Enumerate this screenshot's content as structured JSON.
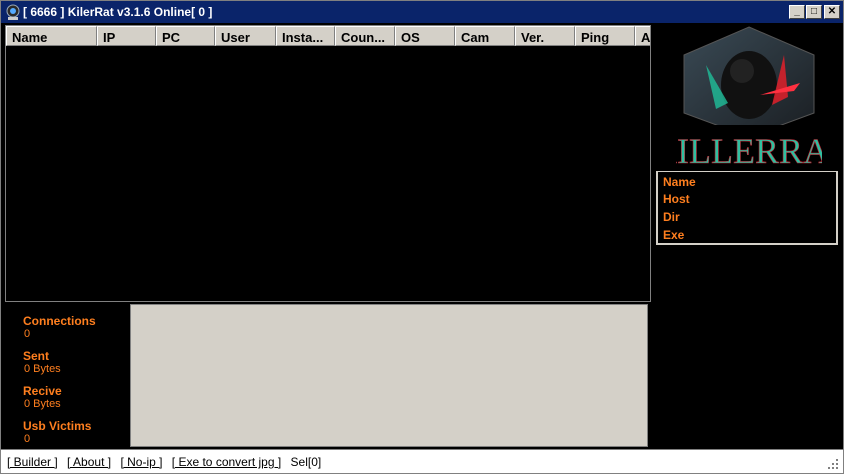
{
  "window": {
    "title": "[ 6666 ] KilerRat v3.1.6 Online[ 0 ]",
    "controls": {
      "minimize": "_",
      "maximize": "□",
      "close": "✕"
    }
  },
  "table": {
    "columns": [
      "Name",
      "IP",
      "PC",
      "User",
      "Insta...",
      "Coun...",
      "OS",
      "Cam",
      "Ver.",
      "Ping",
      "A"
    ]
  },
  "sidepanel": {
    "logo_text": "KILLERRAT",
    "info": {
      "name": "Name",
      "host": "Host",
      "dir": "Dir",
      "exe": "Exe"
    }
  },
  "stats": {
    "connections_label": "Connections",
    "connections_value": "0",
    "sent_label": "Sent",
    "sent_value": "0 Bytes",
    "recive_label": "Recive",
    "recive_value": "0 Bytes",
    "usb_label": "Usb Victims",
    "usb_value": "0"
  },
  "statusbar": {
    "builder": "[ Builder ]",
    "about": "[ About ]",
    "noip": "[ No-ip ]",
    "exe_jpg": "[ Exe to convert jpg ]",
    "sel": "Sel[0]"
  },
  "colors": {
    "accent": "#ff7f1f",
    "title_bg": "#0a246a",
    "logo_text": "#2fbfa0"
  }
}
